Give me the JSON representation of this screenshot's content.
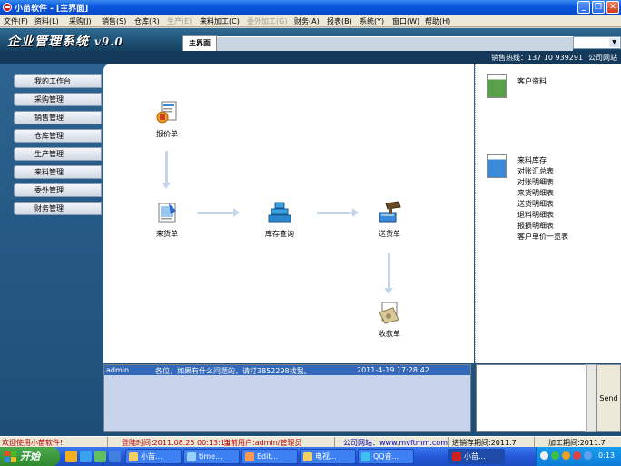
{
  "window": {
    "title": "小苗软件 - [主界面]"
  },
  "menu": [
    {
      "label": "文件(F)",
      "disabled": false
    },
    {
      "label": "资料(L)",
      "disabled": false
    },
    {
      "label": "采购(J)",
      "disabled": false
    },
    {
      "label": "销售(S)",
      "disabled": false
    },
    {
      "label": "仓库(R)",
      "disabled": false
    },
    {
      "label": "生产(E)",
      "disabled": true
    },
    {
      "label": "来料加工(C)",
      "disabled": false
    },
    {
      "label": "委外加工(G)",
      "disabled": true
    },
    {
      "label": "财务(A)",
      "disabled": false
    },
    {
      "label": "报表(B)",
      "disabled": false
    },
    {
      "label": "系统(Y)",
      "disabled": false
    },
    {
      "label": "窗口(W)",
      "disabled": false
    },
    {
      "label": "帮助(H)",
      "disabled": false
    }
  ],
  "banner": {
    "logo_text": "企业管理系统",
    "version": "v9.0",
    "active_tab": "主界面"
  },
  "info": {
    "hotline": "销售热线：137 10 939291",
    "website_label": "公司网站"
  },
  "sidebar": {
    "items": [
      {
        "label": "我的工作台"
      },
      {
        "label": "采购管理"
      },
      {
        "label": "销售管理"
      },
      {
        "label": "仓库管理"
      },
      {
        "label": "生产管理"
      },
      {
        "label": "来料管理"
      },
      {
        "label": "委外管理"
      },
      {
        "label": "财务管理"
      }
    ]
  },
  "flow": {
    "quote": "报价单",
    "incoming": "来货单",
    "inventory": "库存查询",
    "delivery": "送货单",
    "receipt": "收款单"
  },
  "right_panel": {
    "customer_info": "客户资料",
    "reports": [
      "来料库存",
      "对账汇总表",
      "对账明细表",
      "来货明细表",
      "送货明细表",
      "退料明细表",
      "报损明细表",
      "客户单价一览表"
    ]
  },
  "chat": {
    "user": "admin",
    "message": "各位，如果有什么问题的，请打3852298找我。",
    "time": "2011-4-19 17:28:42",
    "send_label": "Send"
  },
  "status": {
    "welcome": "欢迎使用小苗软件!",
    "login_time": "登陆时间:2011.08.25 00:13:11",
    "current_user": "当前用户:admin/管理员",
    "website": "公司网站：www.mvftmm.com",
    "inventory_period": "进销存期间:2011.7",
    "processing_period": "加工期间:2011.7"
  },
  "taskbar": {
    "start_label": "开始",
    "tasks": [
      "小苗...",
      "time...",
      "Edit...",
      "电视...",
      "QQ音...",
      "小苗..."
    ],
    "clock": "0:13"
  }
}
